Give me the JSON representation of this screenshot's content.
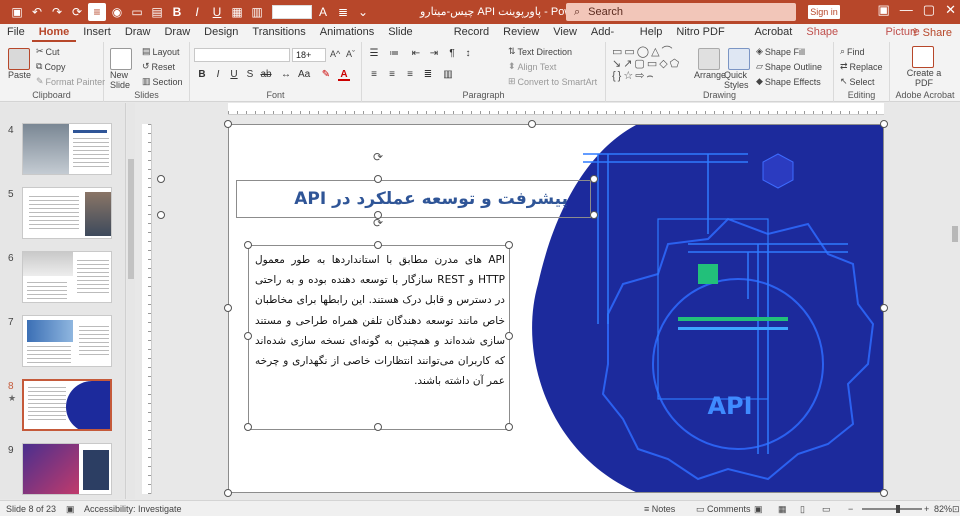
{
  "titlebar": {
    "doc_title": "چیس-میتارو API پاورپوینت  -  PowerPoint",
    "search_placeholder": "Search",
    "signin": "Sign in",
    "brand_color": "#b7472a"
  },
  "tabs": [
    "File",
    "Home",
    "Insert",
    "Draw",
    "Draw",
    "Design",
    "Transitions",
    "Animations",
    "Slide Show",
    "Record",
    "Review",
    "View",
    "Add-ins",
    "Help",
    "Nitro PDF Pro",
    "Acrobat",
    "Shape Format",
    "Picture Format"
  ],
  "share_label": "Share",
  "ribbon": {
    "clipboard": {
      "label": "Clipboard",
      "paste": "Paste",
      "cut": "Cut",
      "copy": "Copy",
      "format_painter": "Format Painter"
    },
    "slides": {
      "label": "Slides",
      "new_slide": "New Slide",
      "layout": "Layout",
      "reset": "Reset",
      "section": "Section"
    },
    "font": {
      "label": "Font",
      "font_size": "18+",
      "font_name": ""
    },
    "paragraph": {
      "label": "Paragraph",
      "text_direction": "Text Direction",
      "align_text": "Align Text",
      "smartart": "Convert to SmartArt"
    },
    "drawing": {
      "label": "Drawing",
      "arrange": "Arrange",
      "quick_styles": "Quick Styles",
      "shape_fill": "Shape Fill",
      "shape_outline": "Shape Outline",
      "shape_effects": "Shape Effects"
    },
    "editing": {
      "label": "Editing",
      "find": "Find",
      "replace": "Replace",
      "select": "Select"
    },
    "adobe": {
      "label": "Adobe Acrobat",
      "create_pdf": "Create a PDF"
    }
  },
  "thumbnails": [
    {
      "num": "4",
      "selected": false
    },
    {
      "num": "5",
      "selected": false
    },
    {
      "num": "6",
      "selected": false
    },
    {
      "num": "7",
      "selected": false
    },
    {
      "num": "8",
      "selected": true
    },
    {
      "num": "9",
      "selected": false
    }
  ],
  "slide": {
    "title": "پیشرفت و توسعه عملکرد در API",
    "body": "API های مدرن مطابق با استانداردها به طور معمول HTTP و REST سازگار با توسعه دهنده بوده و به راحتی در دسترس و قابل درک هستند. این رابطها برای مخاطبان خاص مانند توسعه دهندگان تلفن همراه طراحی و مستند سازی شده‌اند و همچنین به گونه‌ای نسخه سازی شده‌اند که کاربران می‌توانند انتظارات خاصی از نگهداری و چرخه عمر آن داشته باشند.",
    "art_label": "API",
    "art_color": "#1c2a9c"
  },
  "status": {
    "slide_count": "Slide 8 of 23",
    "accessibility": "Accessibility: Investigate",
    "notes": "Notes",
    "comments": "Comments",
    "zoom": "82%"
  }
}
